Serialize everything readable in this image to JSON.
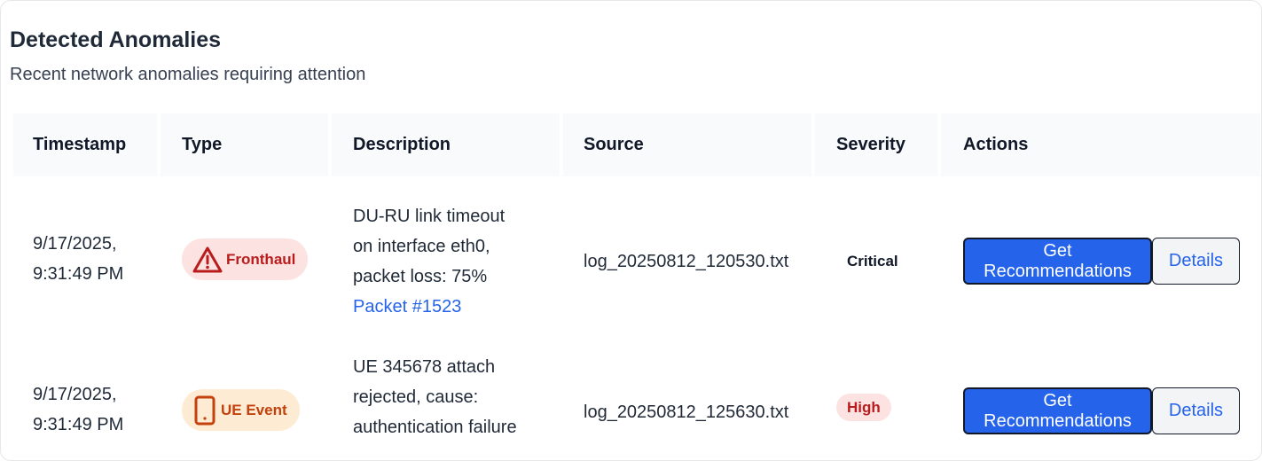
{
  "card": {
    "title": "Detected Anomalies",
    "subtitle": "Recent network anomalies requiring attention"
  },
  "table": {
    "columns": [
      "Timestamp",
      "Type",
      "Description",
      "Source",
      "Severity",
      "Actions"
    ],
    "rows": [
      {
        "timestamp_line1": "9/17/2025,",
        "timestamp_line2": "9:31:49 PM",
        "type": "Fronthaul",
        "type_icon": "warning-triangle-icon",
        "description_line1": "DU-RU link timeout",
        "description_line2": "on interface eth0,",
        "description_line3": "packet loss: 75%",
        "packet_link": "Packet #1523",
        "source": "log_20250812_120530.txt",
        "severity": "Critical",
        "primary_action_line1": "Get",
        "primary_action_line2": "Recommendations",
        "secondary_action": "Details"
      },
      {
        "timestamp_line1": "9/17/2025,",
        "timestamp_line2": "9:31:49 PM",
        "type": "UE Event",
        "type_icon": "mobile-device-icon",
        "description_line1": "UE 345678 attach",
        "description_line2": "rejected, cause:",
        "description_line3": "authentication failure",
        "source": "log_20250812_125630.txt",
        "severity": "High",
        "primary_action_line1": "Get",
        "primary_action_line2": "Recommendations",
        "secondary_action": "Details"
      }
    ]
  },
  "colors": {
    "primary": "#2563eb",
    "critical_badge_bg": "#fde2e2",
    "critical_text": "#b91c1c",
    "ue_badge_bg": "#fdebd3",
    "ue_text": "#c2410c",
    "header_bg": "#f8fafc"
  }
}
